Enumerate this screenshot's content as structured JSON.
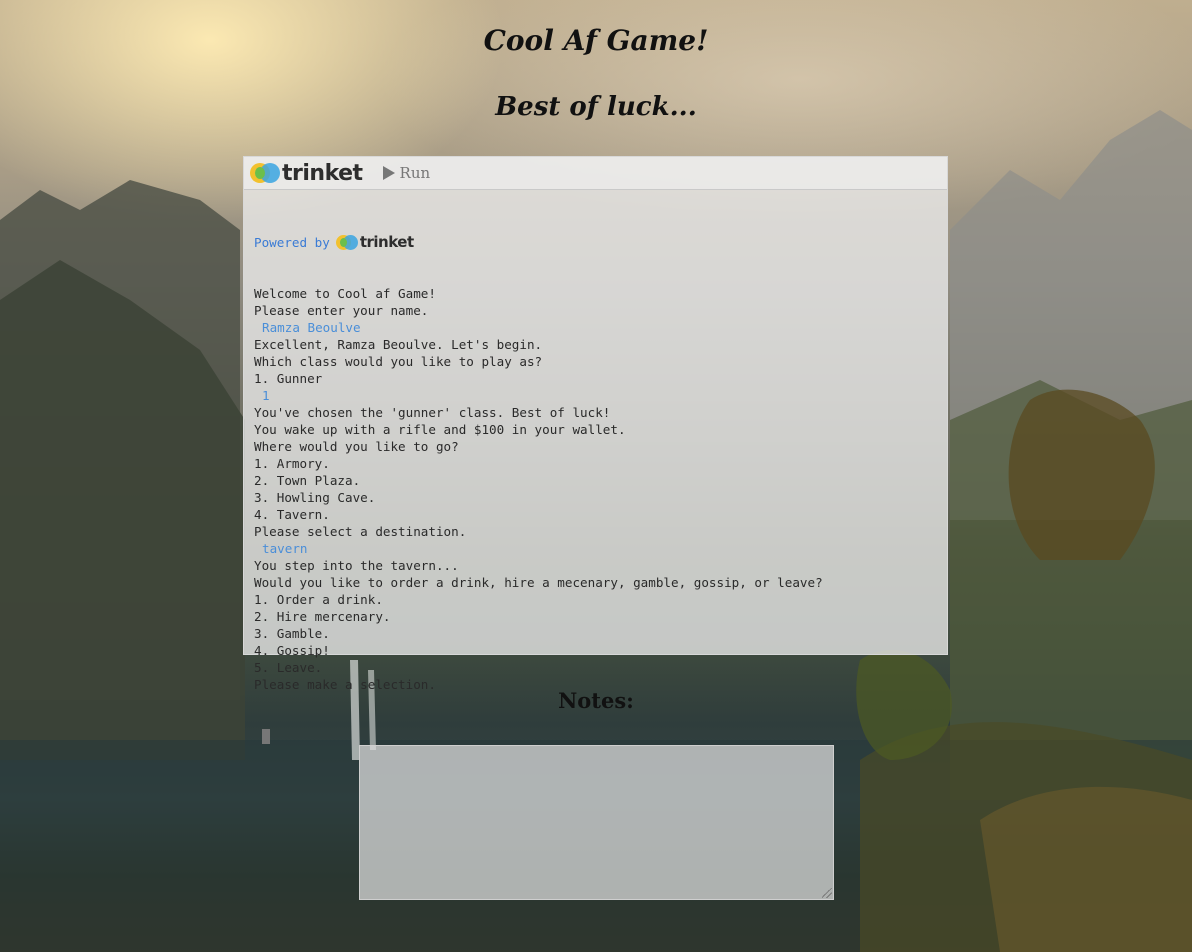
{
  "page": {
    "title": "Cool Af Game!",
    "subtitle": "Best of luck..."
  },
  "trinket": {
    "logo_text": "trinket",
    "run_label": "Run",
    "powered_by": "Powered by",
    "powered_logo_text": "trinket",
    "lines": [
      {
        "text": "Welcome to Cool af Game!",
        "kind": "output"
      },
      {
        "text": "Please enter your name.",
        "kind": "output"
      },
      {
        "text": "Ramza Beoulve",
        "kind": "input"
      },
      {
        "text": "Excellent, Ramza Beoulve. Let's begin.",
        "kind": "output"
      },
      {
        "text": "Which class would you like to play as?",
        "kind": "output"
      },
      {
        "text": "1. Gunner",
        "kind": "output"
      },
      {
        "text": "1",
        "kind": "input"
      },
      {
        "text": "You've chosen the 'gunner' class. Best of luck!",
        "kind": "output"
      },
      {
        "text": "You wake up with a rifle and $100 in your wallet.",
        "kind": "output"
      },
      {
        "text": "Where would you like to go?",
        "kind": "output"
      },
      {
        "text": "1. Armory.",
        "kind": "output"
      },
      {
        "text": "2. Town Plaza.",
        "kind": "output"
      },
      {
        "text": "3. Howling Cave.",
        "kind": "output"
      },
      {
        "text": "4. Tavern.",
        "kind": "output"
      },
      {
        "text": "Please select a destination.",
        "kind": "output"
      },
      {
        "text": "tavern",
        "kind": "input"
      },
      {
        "text": "You step into the tavern...",
        "kind": "output"
      },
      {
        "text": "Would you like to order a drink, hire a mecenary, gamble, gossip, or leave?",
        "kind": "output"
      },
      {
        "text": "1. Order a drink.",
        "kind": "output"
      },
      {
        "text": "2. Hire mercenary.",
        "kind": "output"
      },
      {
        "text": "3. Gamble.",
        "kind": "output"
      },
      {
        "text": "4. Gossip!",
        "kind": "output"
      },
      {
        "text": "5. Leave.",
        "kind": "output"
      },
      {
        "text": "Please make a selection.",
        "kind": "output"
      }
    ]
  },
  "notes": {
    "label": "Notes:",
    "value": ""
  },
  "colors": {
    "input_text": "#4a8ed8",
    "powered_text": "#3a7bd5"
  }
}
